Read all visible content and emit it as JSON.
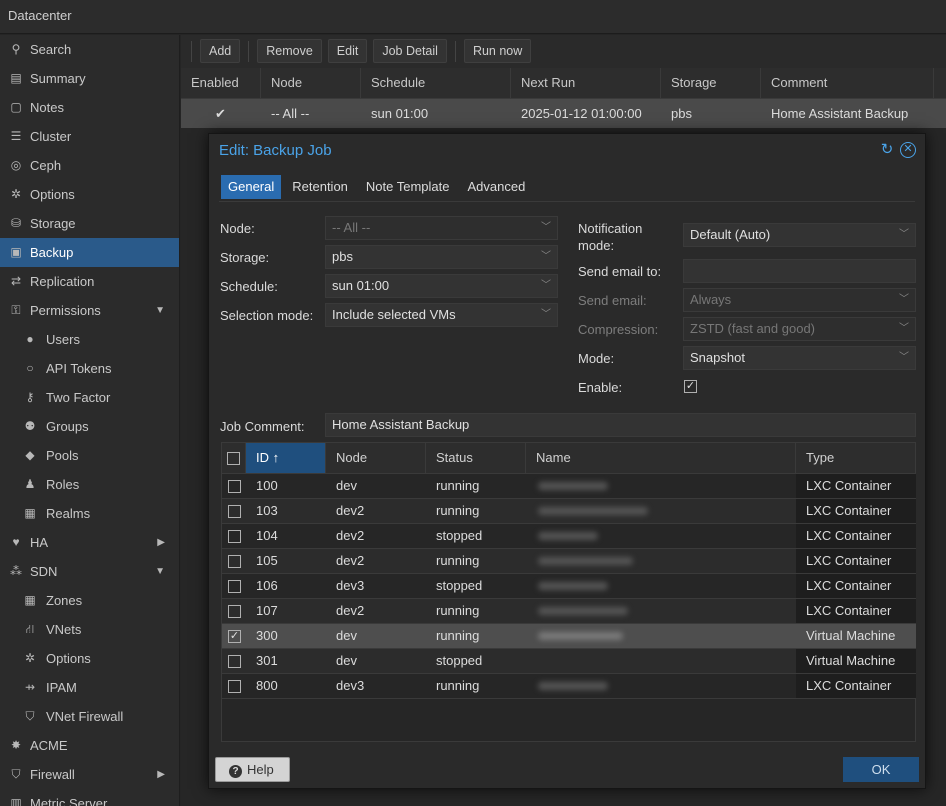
{
  "topbar": {
    "title": "Datacenter"
  },
  "sidebar": {
    "items": [
      {
        "label": "Search",
        "icon": "search-icon",
        "glyph": "⚲"
      },
      {
        "label": "Summary",
        "icon": "book-icon",
        "glyph": "▤"
      },
      {
        "label": "Notes",
        "icon": "notes-icon",
        "glyph": "▢"
      },
      {
        "label": "Cluster",
        "icon": "server-icon",
        "glyph": "☰"
      },
      {
        "label": "Ceph",
        "icon": "ceph-icon",
        "glyph": "◎"
      },
      {
        "label": "Options",
        "icon": "gear-icon",
        "glyph": "✲"
      },
      {
        "label": "Storage",
        "icon": "database-icon",
        "glyph": "⛁"
      },
      {
        "label": "Backup",
        "icon": "floppy-icon",
        "glyph": "▣",
        "active": true
      },
      {
        "label": "Replication",
        "icon": "retweet-icon",
        "glyph": "⇄"
      },
      {
        "label": "Permissions",
        "icon": "unlock-icon",
        "glyph": "⚿",
        "caret": "▼"
      },
      {
        "label": "Users",
        "icon": "user-icon",
        "glyph": "●",
        "sub": true
      },
      {
        "label": "API Tokens",
        "icon": "user-o-icon",
        "glyph": "○",
        "sub": true
      },
      {
        "label": "Two Factor",
        "icon": "key-icon",
        "glyph": "⚷",
        "sub": true
      },
      {
        "label": "Groups",
        "icon": "users-icon",
        "glyph": "⚉",
        "sub": true
      },
      {
        "label": "Pools",
        "icon": "tags-icon",
        "glyph": "◆",
        "sub": true
      },
      {
        "label": "Roles",
        "icon": "male-icon",
        "glyph": "♟",
        "sub": true
      },
      {
        "label": "Realms",
        "icon": "address-book-icon",
        "glyph": "▦",
        "sub": true
      },
      {
        "label": "HA",
        "icon": "heartbeat-icon",
        "glyph": "♥",
        "caret": "▶"
      },
      {
        "label": "SDN",
        "icon": "sdn-icon",
        "glyph": "⁂",
        "caret": "▼"
      },
      {
        "label": "Zones",
        "icon": "th-icon",
        "glyph": "▦",
        "sub": true
      },
      {
        "label": "VNets",
        "icon": "network-icon",
        "glyph": "⛙",
        "sub": true
      },
      {
        "label": "Options",
        "icon": "gear-icon",
        "glyph": "✲",
        "sub": true
      },
      {
        "label": "IPAM",
        "icon": "signs-icon",
        "glyph": "⇸",
        "sub": true
      },
      {
        "label": "VNet Firewall",
        "icon": "shield-icon",
        "glyph": "⛉",
        "sub": true
      },
      {
        "label": "ACME",
        "icon": "certificate-icon",
        "glyph": "✸"
      },
      {
        "label": "Firewall",
        "icon": "shield-icon",
        "glyph": "⛉",
        "caret": "▶"
      },
      {
        "label": "Metric Server",
        "icon": "bar-chart-icon",
        "glyph": "▥"
      }
    ]
  },
  "toolbar": {
    "add": "Add",
    "remove": "Remove",
    "edit": "Edit",
    "job_detail": "Job Detail",
    "run_now": "Run now"
  },
  "background_table": {
    "columns": [
      "Enabled",
      "Node",
      "Schedule",
      "Next Run",
      "Storage",
      "Comment"
    ],
    "row": {
      "enabled": "✔",
      "node": "-- All --",
      "schedule": "sun 01:00",
      "next_run": "2025-01-12 01:00:00",
      "storage": "pbs",
      "comment": "Home Assistant Backup"
    }
  },
  "dialog": {
    "title": "Edit: Backup Job",
    "tabs": [
      "General",
      "Retention",
      "Note Template",
      "Advanced"
    ],
    "active_tab": "General",
    "left_fields": {
      "node_label": "Node:",
      "node_value": "-- All --",
      "storage_label": "Storage:",
      "storage_value": "pbs",
      "schedule_label": "Schedule:",
      "schedule_value": "sun 01:00",
      "selection_label": "Selection mode:",
      "selection_value": "Include selected VMs"
    },
    "right_fields": {
      "notification_label_1": "Notification",
      "notification_label_2": "mode:",
      "notification_value": "Default (Auto)",
      "send_email_to_label": "Send email to:",
      "send_email_to_value": "",
      "send_email_label": "Send email:",
      "send_email_value": "Always",
      "compression_label": "Compression:",
      "compression_value": "ZSTD (fast and good)",
      "mode_label": "Mode:",
      "mode_value": "Snapshot",
      "enable_label": "Enable:",
      "enable_checked": true
    },
    "job_comment_label": "Job Comment:",
    "job_comment_value": "Home Assistant Backup",
    "grid": {
      "columns": [
        "ID ↑",
        "Node",
        "Status",
        "Name",
        "Type"
      ],
      "rows": [
        {
          "checked": false,
          "id": "100",
          "node": "dev",
          "status": "running",
          "type": "LXC Container"
        },
        {
          "checked": false,
          "id": "103",
          "node": "dev2",
          "status": "running",
          "type": "LXC Container"
        },
        {
          "checked": false,
          "id": "104",
          "node": "dev2",
          "status": "stopped",
          "type": "LXC Container"
        },
        {
          "checked": false,
          "id": "105",
          "node": "dev2",
          "status": "running",
          "type": "LXC Container"
        },
        {
          "checked": false,
          "id": "106",
          "node": "dev3",
          "status": "stopped",
          "type": "LXC Container"
        },
        {
          "checked": false,
          "id": "107",
          "node": "dev2",
          "status": "running",
          "type": "LXC Container"
        },
        {
          "checked": true,
          "id": "300",
          "node": "dev",
          "status": "running",
          "type": "Virtual Machine"
        },
        {
          "checked": false,
          "id": "301",
          "node": "dev",
          "status": "stopped",
          "type": "Virtual Machine"
        },
        {
          "checked": false,
          "id": "800",
          "node": "dev3",
          "status": "running",
          "type": "LXC Container"
        }
      ]
    },
    "help_label": "Help",
    "ok_label": "OK"
  },
  "colors": {
    "accent": "#4aa3e8",
    "active_tab": "#2a6cb0",
    "selected_nav": "#2a5a8a",
    "ok_button": "#1f4f7e"
  }
}
